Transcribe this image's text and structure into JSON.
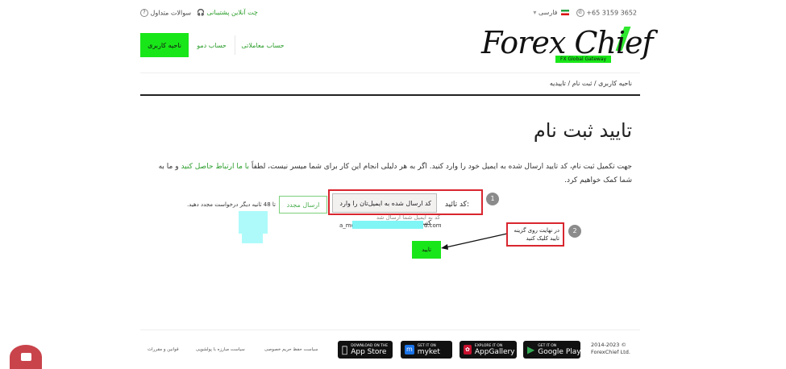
{
  "topbar": {
    "phone": "+65 3159 3652",
    "language": "فارسی",
    "chat": "چت آنلاین پشتیبانی",
    "faq": "سوالات متداول"
  },
  "nav": {
    "user_area": "ناحیه کاربری",
    "demo": "حساب دمو",
    "trading": "حساب معاملاتی"
  },
  "logo": {
    "text": "Forex Chief",
    "tagline": "FX Global Gateway"
  },
  "breadcrumb": "ناحیه کاربری / ثبت نام / تاییدیه",
  "page": {
    "title": "تایید ثبت نام",
    "desc_part1": "جهت تکمیل ثبت نام، کد تایید ارسال شده به ایمیل خود را وارد کنید. اگر به هر دلیلی انجام این کار برای شما میسر نیست، لطفاً ",
    "desc_link": "با ما ارتباط حاصل کنید",
    "desc_part2": " و ما به شما کمک خواهیم کرد."
  },
  "form": {
    "code_label": "کد تائید:",
    "code_value": "کد ارسال شده به ایمیل‌تان را وارد کنید",
    "resend_label": "ارسال مجدد",
    "timer_text": "تا 48 ثانیه دیگر درخواست مجدد دهید.",
    "sent_note": "کد به ایمیل شما ارسال شد",
    "email_start": "a_mo",
    "email_end": "d.com",
    "confirm_label": "تایید"
  },
  "annotations": {
    "step1": "1",
    "step2": "2",
    "step2_text": "در نهایت روی گزینه تایید کلیک کنید"
  },
  "footer": {
    "links": [
      "قوانین و مقررات",
      "سیاست مبارزه با پولشویی",
      "سیاست حفظ حریم خصوصی"
    ],
    "stores": [
      {
        "small": "DOWNLOAD ON THE",
        "big": "App Store",
        "icon": "apple-icon"
      },
      {
        "small": "GET IT ON",
        "big": "myket",
        "icon": "myket-icon"
      },
      {
        "small": "EXPLORE IT ON",
        "big": "AppGallery",
        "icon": "huawei-icon"
      },
      {
        "small": "GET IT ON",
        "big": "Google Play",
        "icon": "google-play-icon"
      }
    ],
    "copyright_years": "2014-2023 ©",
    "copyright_name": "ForexChief Ltd."
  },
  "colors": {
    "accent": "#19e619",
    "link": "#2a9d2a",
    "annotation_red": "#d9262f",
    "chat_bubble": "#c9434b"
  }
}
